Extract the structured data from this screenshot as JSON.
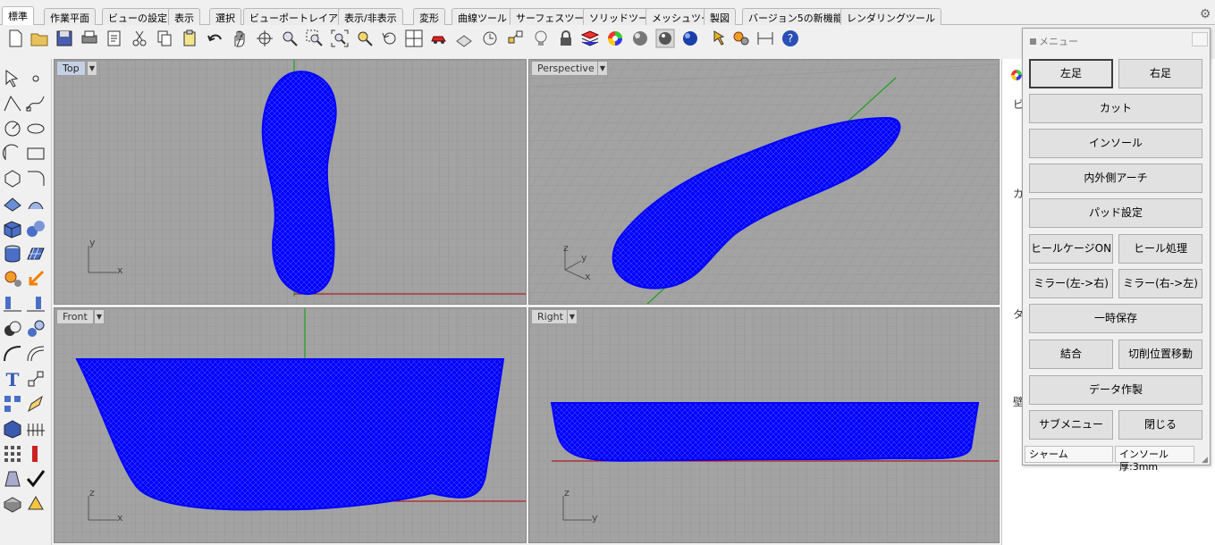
{
  "tabs": [
    "標準",
    "作業平面",
    "ビューの設定",
    "表示",
    "選択",
    "ビューポートレイアウト",
    "表示/非表示",
    "変形",
    "曲線ツール",
    "サーフェスツール",
    "ソリッドツール",
    "メッシュツール",
    "製図",
    "バージョン5の新機能",
    "レンダリングツール"
  ],
  "active_tab": "標準",
  "viewports": {
    "top": "Top",
    "perspective": "Perspective",
    "front": "Front",
    "right": "Right"
  },
  "axes": {
    "x": "x",
    "y": "y",
    "z": "z"
  },
  "side_panel": {
    "l1": "ビ",
    "l2": "カメ",
    "l3": "ター",
    "l4": "壁"
  },
  "menu": {
    "title": "メニュー",
    "buttons": {
      "left_foot": "左足",
      "right_foot": "右足",
      "cut": "カット",
      "insole": "インソール",
      "arch": "内外側アーチ",
      "pad": "パッド設定",
      "heel_cage": "ヒールケージON",
      "heel_proc": "ヒール処理",
      "mirror_lr": "ミラー(左->右)",
      "mirror_rl": "ミラー(右->左)",
      "temp_save": "一時保存",
      "join": "結合",
      "cut_move": "切削位置移動",
      "data_make": "データ作製",
      "submenu": "サブメニュー",
      "close": "閉じる"
    },
    "status_left": "シャーム",
    "status_right": "インソール厚:3mm"
  },
  "colors": {
    "mesh": "#0000ff",
    "grid_bg": "#a3a3a3",
    "x_axis": "#b00000",
    "y_axis": "#00a000"
  }
}
